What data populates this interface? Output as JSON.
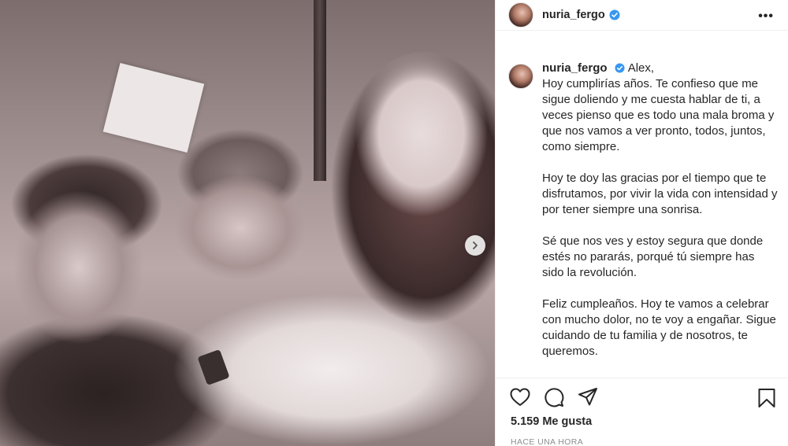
{
  "post": {
    "image_alt": "Vintage black and white photo of a group of young people",
    "next_icon": "chevron-right-icon"
  },
  "header": {
    "username": "nuria_fergo",
    "verified_icon": "verified-badge-icon",
    "more_label": "•••"
  },
  "caption": {
    "username": "nuria_fergo",
    "paragraphs": [
      "Alex,\nHoy cumplirías años. Te confieso que me sigue doliendo y me cuesta hablar de ti, a veces pienso que es todo una mala broma y que nos vamos a ver pronto, todos, juntos, como siempre.",
      "Hoy te doy las gracias por el tiempo que te disfrutamos, por vivir la vida con intensidad y por tener siempre una sonrisa.",
      "Sé que nos ves y estoy segura que donde estés no pararás, porqué tú siempre has sido la revolución.",
      "Feliz cumpleaños. Hoy te vamos a celebrar con mucho dolor, no te voy a engañar. Sigue cuidando de tu familia y de nosotros, te queremos."
    ]
  },
  "actions": {
    "like_icon": "heart-icon",
    "comment_icon": "comment-icon",
    "share_icon": "share-icon",
    "save_icon": "bookmark-icon"
  },
  "stats": {
    "likes": "5.159 Me gusta",
    "time_ago": "HACE UNA HORA"
  },
  "colors": {
    "verified": "#3897f0",
    "text": "#262626",
    "muted": "#8e8e8e",
    "border": "#efefef"
  }
}
